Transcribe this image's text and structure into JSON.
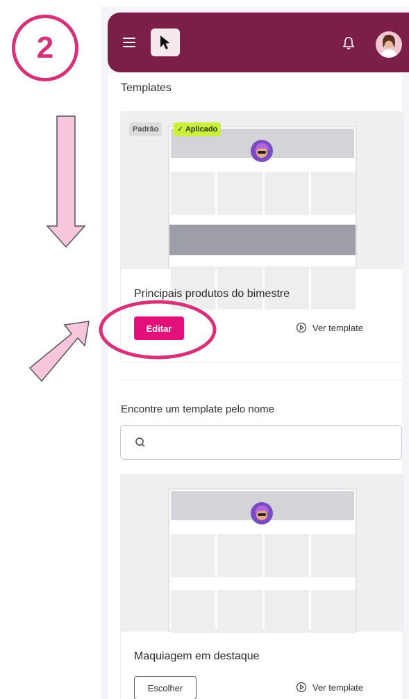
{
  "annotation": {
    "step_number": "2"
  },
  "header": {
    "menu_icon": "menu-icon",
    "logo_icon": "cursor-arrow-icon",
    "bell_icon": "bell-icon",
    "brand_color": "#7b1f48"
  },
  "section": {
    "title": "Templates"
  },
  "current_template": {
    "badge_default": "Padrão",
    "badge_applied": "✓ Aplicado",
    "name": "Principais produtos do bimestre",
    "edit_label": "Editar",
    "view_label": "Ver template"
  },
  "search": {
    "label": "Encontre um template pelo nome",
    "placeholder": "",
    "value": ""
  },
  "templates": [
    {
      "name": "Maquiagem em destaque",
      "choose_label": "Escolher",
      "view_label": "Ver template"
    }
  ],
  "colors": {
    "accent": "#e3107b",
    "annotation": "#d6327a",
    "applied_badge": "#c9f03c",
    "arrow_fill": "#f7c6dc"
  }
}
